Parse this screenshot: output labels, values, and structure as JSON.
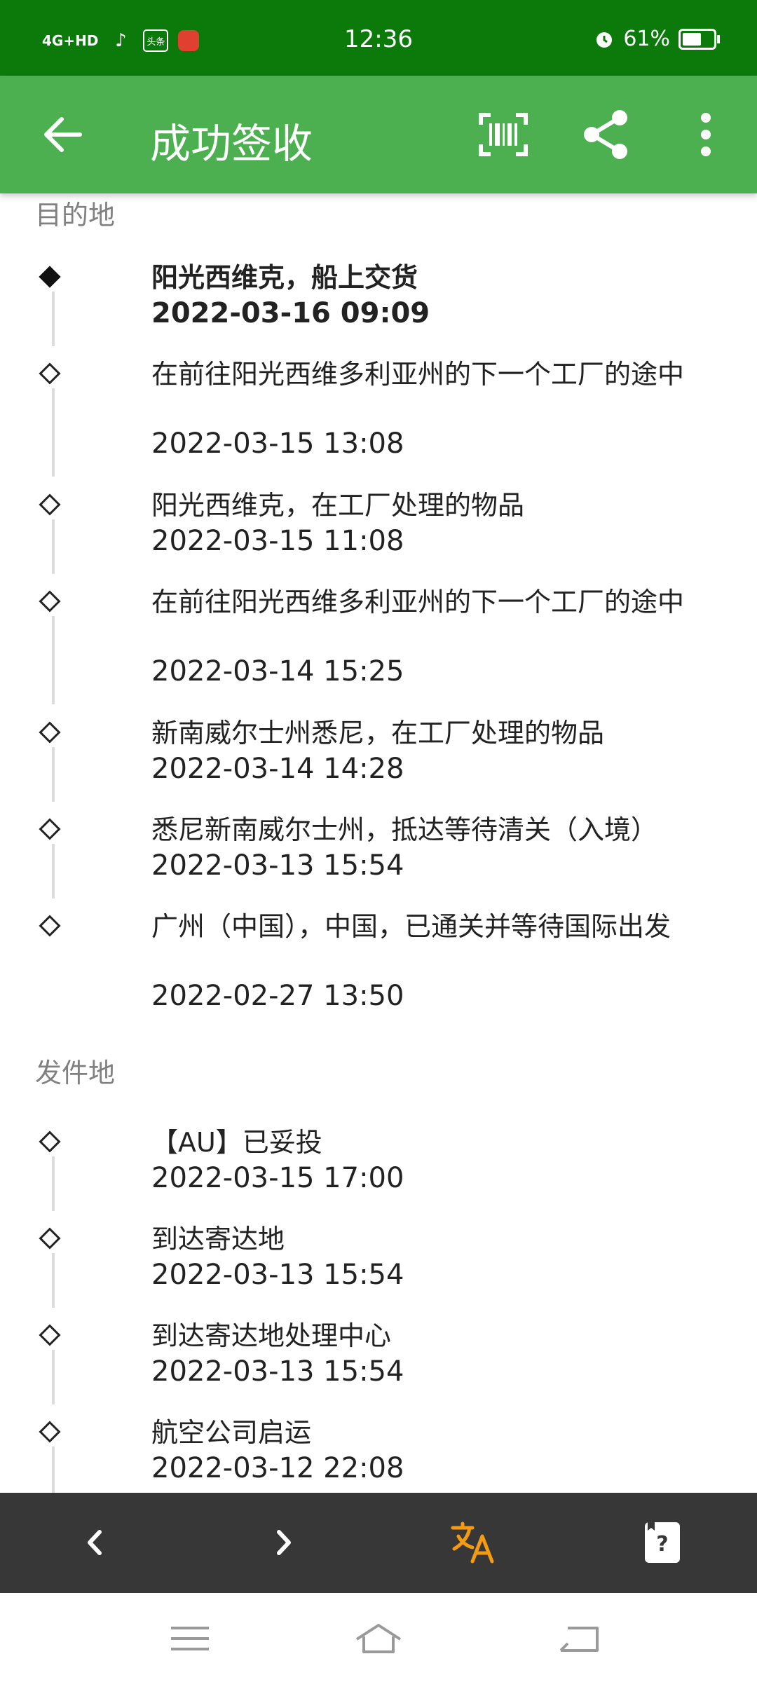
{
  "status_bar": {
    "network": "4G+HD",
    "app_icons": [
      "tiktok-icon",
      "toutiao-icon",
      "app-red-icon"
    ],
    "toutiao_label": "头条",
    "time": "12:36",
    "battery_percent": "61%",
    "battery_level": 0.61
  },
  "app_bar": {
    "title": "成功签收"
  },
  "destination": {
    "title": "目的地",
    "events": [
      {
        "text": "阳光西维克，船上交货",
        "time": "2022-03-16 09:09",
        "current": true
      },
      {
        "text": "在前往阳光西维多利亚州的下一个工厂的途中",
        "time": "2022-03-15 13:08"
      },
      {
        "text": "阳光西维克，在工厂处理的物品",
        "time": "2022-03-15 11:08"
      },
      {
        "text": "在前往阳光西维多利亚州的下一个工厂的途中",
        "time": "2022-03-14 15:25"
      },
      {
        "text": "新南威尔士州悉尼，在工厂处理的物品",
        "time": "2022-03-14 14:28"
      },
      {
        "text": "悉尼新南威尔士州，抵达等待清关（入境）",
        "time": "2022-03-13 15:54"
      },
      {
        "text": "广州（中国），中国，已通关并等待国际出发",
        "time": "2022-02-27 13:50"
      }
    ]
  },
  "origin": {
    "title": "发件地",
    "events": [
      {
        "text": "【AU】已妥投",
        "time": "2022-03-15 17:00"
      },
      {
        "text": "到达寄达地",
        "time": "2022-03-13 15:54"
      },
      {
        "text": "到达寄达地处理中心",
        "time": "2022-03-13 15:54"
      },
      {
        "text": "航空公司启运",
        "time": "2022-03-12 22:08"
      }
    ]
  },
  "bottom_bar": {
    "accent_color": "#f39c12",
    "buttons": [
      "chevron-left-icon",
      "chevron-right-icon",
      "translate-icon",
      "help-card-icon"
    ]
  },
  "colors": {
    "status_bar": "#0b7a0b",
    "app_bar": "#4caf50",
    "bottom_bar": "#373737"
  }
}
